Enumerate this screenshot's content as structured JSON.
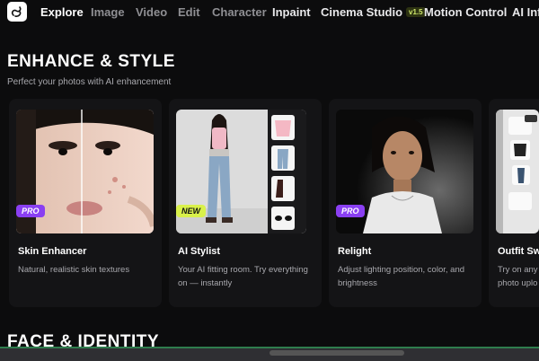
{
  "nav": {
    "items": [
      {
        "label": "Explore"
      },
      {
        "label": "Image"
      },
      {
        "label": "Video"
      },
      {
        "label": "Edit"
      },
      {
        "label": "Character"
      },
      {
        "label": "Inpaint"
      },
      {
        "label": "Cinema Studio",
        "badge": "v1.5"
      },
      {
        "label": "Motion Control"
      },
      {
        "label": "AI Infl"
      }
    ]
  },
  "sections": {
    "enhance": {
      "title": "ENHANCE & STYLE",
      "subtitle": "Perfect your photos with AI enhancement"
    },
    "face": {
      "title": "FACE & IDENTITY"
    }
  },
  "cards": [
    {
      "title": "Skin Enhancer",
      "desc": "Natural, realistic skin textures",
      "tag": "PRO"
    },
    {
      "title": "AI Stylist",
      "desc": "Your AI fitting room. Try everything on — instantly",
      "tag": "NEW"
    },
    {
      "title": "Relight",
      "desc": "Adjust lighting position, color, and brightness",
      "tag": "PRO"
    },
    {
      "title": "Outfit Sw",
      "desc": "Try on any photo uplo"
    }
  ],
  "colors": {
    "accent_pro": "#8a3ff2",
    "accent_new": "#d9f14a",
    "background": "#0c0c0d"
  }
}
